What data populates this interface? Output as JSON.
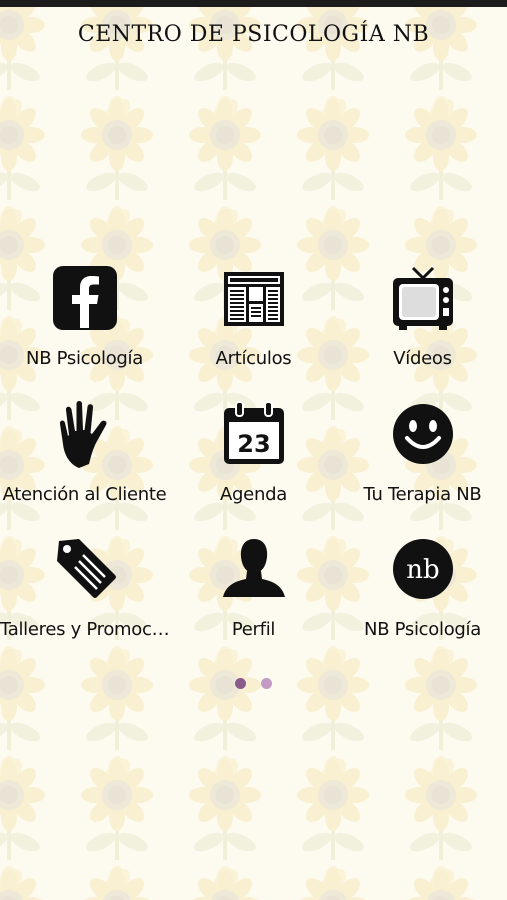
{
  "app": {
    "title": "CENTRO DE PSICOLOGÍA NB"
  },
  "colors": {
    "page_dot_active": "#8a5a8a",
    "page_dot_inactive": "#c49ac4",
    "icon": "#111111"
  },
  "tiles": [
    {
      "label": "NB Psicología",
      "icon": "facebook-icon"
    },
    {
      "label": "Artículos",
      "icon": "newspaper-icon"
    },
    {
      "label": "Vídeos",
      "icon": "tv-icon"
    },
    {
      "label": "Atención al Cliente",
      "icon": "hand-icon"
    },
    {
      "label": "Agenda",
      "icon": "calendar-icon",
      "icon_text": "23"
    },
    {
      "label": "Tu Terapia NB",
      "icon": "smiley-icon"
    },
    {
      "label": "Talleres y Promoc…",
      "icon": "tag-icon"
    },
    {
      "label": "Perfil",
      "icon": "profile-icon"
    },
    {
      "label": "NB Psicología",
      "icon": "nb-logo-icon",
      "icon_text": "nb"
    }
  ],
  "pagination": {
    "pages": 2,
    "current": 1
  }
}
